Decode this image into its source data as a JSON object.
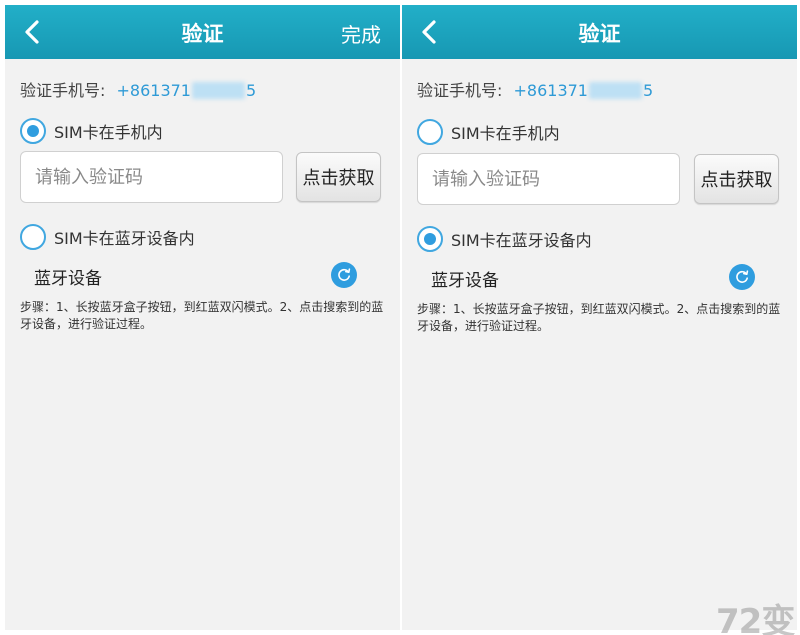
{
  "left": {
    "title": "验证",
    "done_label": "完成",
    "phone_label": "验证手机号:",
    "phone_number": "+861371",
    "phone_suffix": "5",
    "option_sim_phone": "SIM卡在手机内",
    "code_placeholder": "请输入验证码",
    "get_code_label": "点击获取",
    "option_sim_bluetooth": "SIM卡在蓝牙设备内",
    "bt_device_label": "蓝牙设备",
    "steps_text": "步骤：1、长按蓝牙盒子按钮，到红蓝双闪模式。2、点击搜索到的蓝牙设备，进行验证过程。",
    "selected_option": "sim_phone"
  },
  "right": {
    "title": "验证",
    "phone_label": "验证手机号:",
    "phone_number": "+861371",
    "phone_suffix": "5",
    "option_sim_phone": "SIM卡在手机内",
    "code_placeholder": "请输入验证码",
    "get_code_label": "点击获取",
    "option_sim_bluetooth": "SIM卡在蓝牙设备内",
    "bt_device_label": "蓝牙设备",
    "steps_text": "步骤：1、长按蓝牙盒子按钮，到红蓝双闪模式。2、点击搜索到的蓝牙设备，进行验证过程。",
    "selected_option": "sim_bluetooth"
  },
  "watermark": "72变",
  "colors": {
    "header": "#1fa8c2",
    "accent": "#2f9ddf",
    "background": "#f2f2f2"
  },
  "icons": {
    "back": "chevron-left-icon",
    "refresh": "refresh-icon"
  }
}
